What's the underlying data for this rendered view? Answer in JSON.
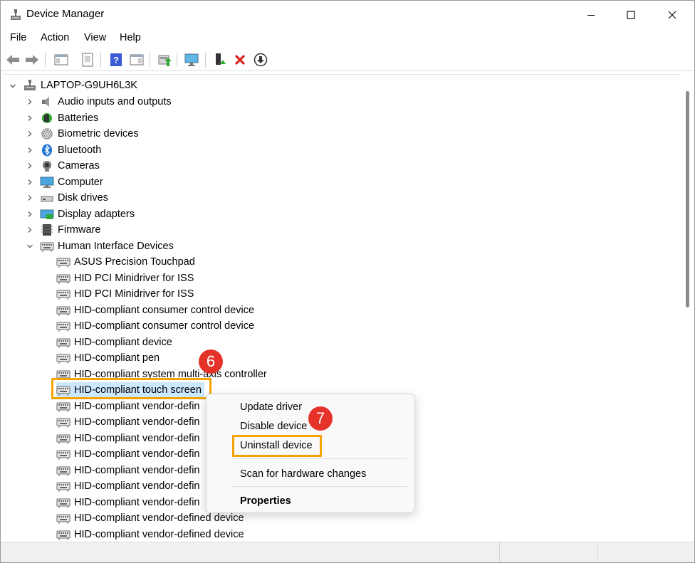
{
  "window": {
    "title": "Device Manager"
  },
  "menubar": {
    "items": [
      "File",
      "Action",
      "View",
      "Help"
    ]
  },
  "toolbar": {
    "buttons": [
      "back-icon",
      "forward-icon",
      "show-hide-console-tree-icon",
      "properties-icon",
      "help-icon",
      "action-pane-icon",
      "update-driver-icon",
      "monitor-icon",
      "enable-device-icon",
      "uninstall-icon",
      "download-icon"
    ]
  },
  "tree": {
    "root": "LAPTOP-G9UH6L3K",
    "categories": [
      "Audio inputs and outputs",
      "Batteries",
      "Biometric devices",
      "Bluetooth",
      "Cameras",
      "Computer",
      "Disk drives",
      "Display adapters",
      "Firmware",
      "Human Interface Devices"
    ],
    "hid_children": [
      "ASUS Precision Touchpad",
      "HID PCI Minidriver for ISS",
      "HID PCI Minidriver for ISS",
      "HID-compliant consumer control device",
      "HID-compliant consumer control device",
      "HID-compliant device",
      "HID-compliant pen",
      "HID-compliant system multi-axis controller",
      "HID-compliant touch screen",
      "HID-compliant vendor-defin",
      "HID-compliant vendor-defin",
      "HID-compliant vendor-defin",
      "HID-compliant vendor-defin",
      "HID-compliant vendor-defin",
      "HID-compliant vendor-defin",
      "HID-compliant vendor-defin",
      "HID-compliant vendor-defined device",
      "HID-compliant vendor-defined device"
    ],
    "selected": "HID-compliant touch screen"
  },
  "context_menu": {
    "items": [
      "Update driver",
      "Disable device",
      "Uninstall device",
      "Scan for hardware changes",
      "Properties"
    ],
    "highlighted": "Uninstall device"
  },
  "annotations": {
    "step6": "6",
    "step7": "7"
  },
  "colors": {
    "highlight": "#f5a300",
    "badge": "#e5332a",
    "selection": "#cce8ff"
  }
}
